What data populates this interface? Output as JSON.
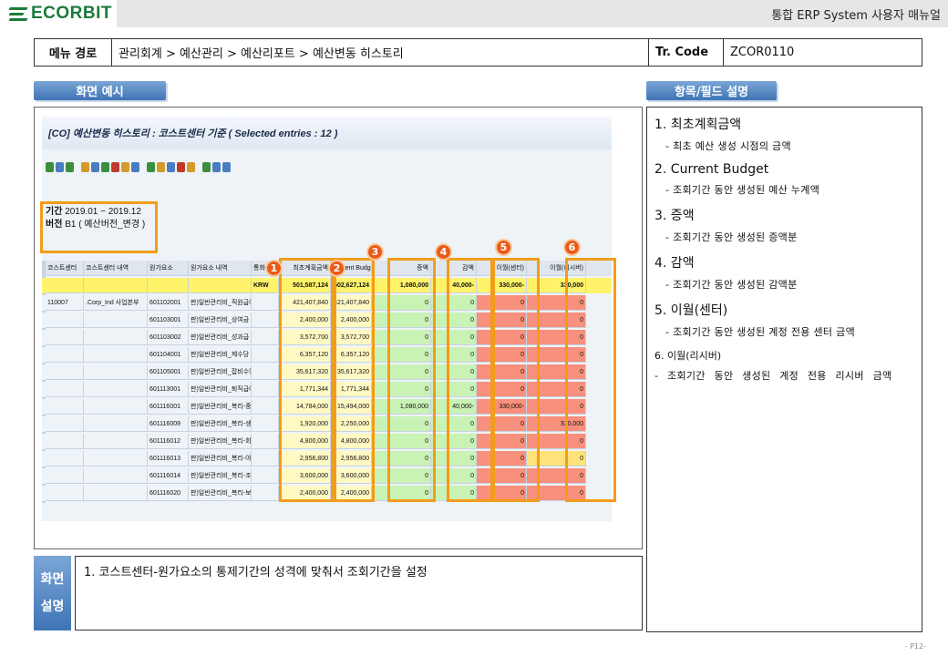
{
  "header": {
    "logo_text": "ECORBIT",
    "manual_title": "통합 ERP System 사용자 매뉴얼"
  },
  "meta": {
    "menu_path_label": "메뉴 경로",
    "menu_path": "관리회계 > 예산관리 > 예산리포트 > 예산변동 히스토리",
    "tcode_label": "Tr. Code",
    "tcode": "ZCOR0110"
  },
  "tabs": {
    "screen_example": "화면 예시",
    "field_desc": "항목/필드 설명"
  },
  "sap": {
    "title": "[CO] 예산변동 히스토리 : 코스트센터 기준 ( Selected entries : 12 )",
    "period_label": "기간",
    "period_value": "2019.01 ~ 2019.12",
    "version_label": "버전",
    "version_value": "B1 ( 예산버전_변경 )",
    "columns": [
      "코스트센터",
      "코스트센터 내역",
      "원가요소",
      "원가요소 내역",
      "통화",
      "최초계획금액",
      "Current Budget",
      "증액",
      "감액",
      "이월(센터)",
      "이월(리시버)"
    ],
    "total_row": {
      "currency": "KRW",
      "initial": "501,587,124",
      "current": "502,627,124",
      "increase": "1,080,000",
      "decrease": "40,000-",
      "carry_center": "330,000-",
      "carry_receiver": "330,000"
    },
    "rows": [
      {
        "cc": "110007",
        "cc_name": ".Corp_Ind 사업본부",
        "ce": "601102001",
        "ce_name": "판)일반관리비_직원급여",
        "initial": "421,407,840",
        "current": "421,407,840",
        "increase": "0",
        "decrease": "0",
        "carry_center": "0",
        "carry_receiver": "0"
      },
      {
        "cc": "",
        "cc_name": "",
        "ce": "601103001",
        "ce_name": "판)일반관리비_상여금",
        "initial": "2,400,000",
        "current": "2,400,000",
        "increase": "0",
        "decrease": "0",
        "carry_center": "0",
        "carry_receiver": "0"
      },
      {
        "cc": "",
        "cc_name": "",
        "ce": "601103002",
        "ce_name": "판)일반관리비_성과급",
        "initial": "3,572,700",
        "current": "3,572,700",
        "increase": "0",
        "decrease": "0",
        "carry_center": "0",
        "carry_receiver": "0"
      },
      {
        "cc": "",
        "cc_name": "",
        "ce": "601104001",
        "ce_name": "판)일반관리비_제수당",
        "initial": "6,357,120",
        "current": "6,357,120",
        "increase": "0",
        "decrease": "0",
        "carry_center": "0",
        "carry_receiver": "0"
      },
      {
        "cc": "",
        "cc_name": "",
        "ce": "601105001",
        "ce_name": "판)일반관리비_잡비수당",
        "initial": "35,617,320",
        "current": "35,617,320",
        "increase": "0",
        "decrease": "0",
        "carry_center": "0",
        "carry_receiver": "0"
      },
      {
        "cc": "",
        "cc_name": "",
        "ce": "601113001",
        "ce_name": "판)일반관리비_퇴직급여충당금",
        "initial": "1,771,344",
        "current": "1,771,344",
        "increase": "0",
        "decrease": "0",
        "carry_center": "0",
        "carry_receiver": "0"
      },
      {
        "cc": "",
        "cc_name": "",
        "ce": "601116001",
        "ce_name": "판)일반관리비_복리-중식대",
        "initial": "14,784,000",
        "current": "15,494,000",
        "increase": "1,080,000",
        "decrease": "40,000-",
        "carry_center": "330,000-",
        "carry_receiver": "0"
      },
      {
        "cc": "",
        "cc_name": "",
        "ce": "601116009",
        "ce_name": "판)일반관리비_복리-생일축하금",
        "initial": "1,920,000",
        "current": "2,250,000",
        "increase": "0",
        "decrease": "0",
        "carry_center": "0",
        "carry_receiver": "330,000"
      },
      {
        "cc": "",
        "cc_name": "",
        "ce": "601116012",
        "ce_name": "판)일반관리비_복리-회의식대",
        "initial": "4,800,000",
        "current": "4,800,000",
        "increase": "0",
        "decrease": "0",
        "carry_center": "0",
        "carry_receiver": "0"
      },
      {
        "cc": "",
        "cc_name": "",
        "ce": "601116013",
        "ce_name": "판)일반관리비_복리-야근식대",
        "initial": "2,956,800",
        "current": "2,956,800",
        "increase": "0",
        "decrease": "0",
        "carry_center": "0",
        "carry_receiver": "0"
      },
      {
        "cc": "",
        "cc_name": "",
        "ce": "601116014",
        "ce_name": "판)일반관리비_복리-조직운영비",
        "initial": "3,600,000",
        "current": "3,600,000",
        "increase": "0",
        "decrease": "0",
        "carry_center": "0",
        "carry_receiver": "0"
      },
      {
        "cc": "",
        "cc_name": "",
        "ce": "601116020",
        "ce_name": "판)일반관리비_복리-보험료",
        "initial": "2,400,000",
        "current": "2,400,000",
        "increase": "0",
        "decrease": "0",
        "carry_center": "0",
        "carry_receiver": "0"
      }
    ],
    "badges": [
      "1",
      "2",
      "3",
      "4",
      "5",
      "6"
    ]
  },
  "screen_desc": {
    "tab_line1": "화면",
    "tab_line2": "설명",
    "text": "1.  코스트센터-원가요소의 통제기간의 성격에 맞춰서 조회기간을 설정"
  },
  "fields": [
    {
      "title": "1.  최초계획금액",
      "desc": "- 최초 예산 생성 시점의 금액"
    },
    {
      "title": "2. Current Budget",
      "desc": "- 조회기간 동안 생성된 예산 누계액"
    },
    {
      "title": "3. 증액",
      "desc": "- 조회기간 동안 생성된 증액분"
    },
    {
      "title": "4. 감액",
      "desc": "- 조회기간 동안 생성된 감액분"
    },
    {
      "title": "5. 이월(센터)",
      "desc": "- 조회기간 동안 생성된 계정 전용 센터 금액"
    },
    {
      "title": "6. 이월(리시버)",
      "desc": "- 조회기간 동안 생성된 계정 전용 리시버 금액"
    }
  ],
  "page_number": "- P12-",
  "colors": {
    "brand": "#1d7a3a",
    "tab": "#3f74b5",
    "highlight": "#f39c1a",
    "badge": "#e85b1a"
  }
}
